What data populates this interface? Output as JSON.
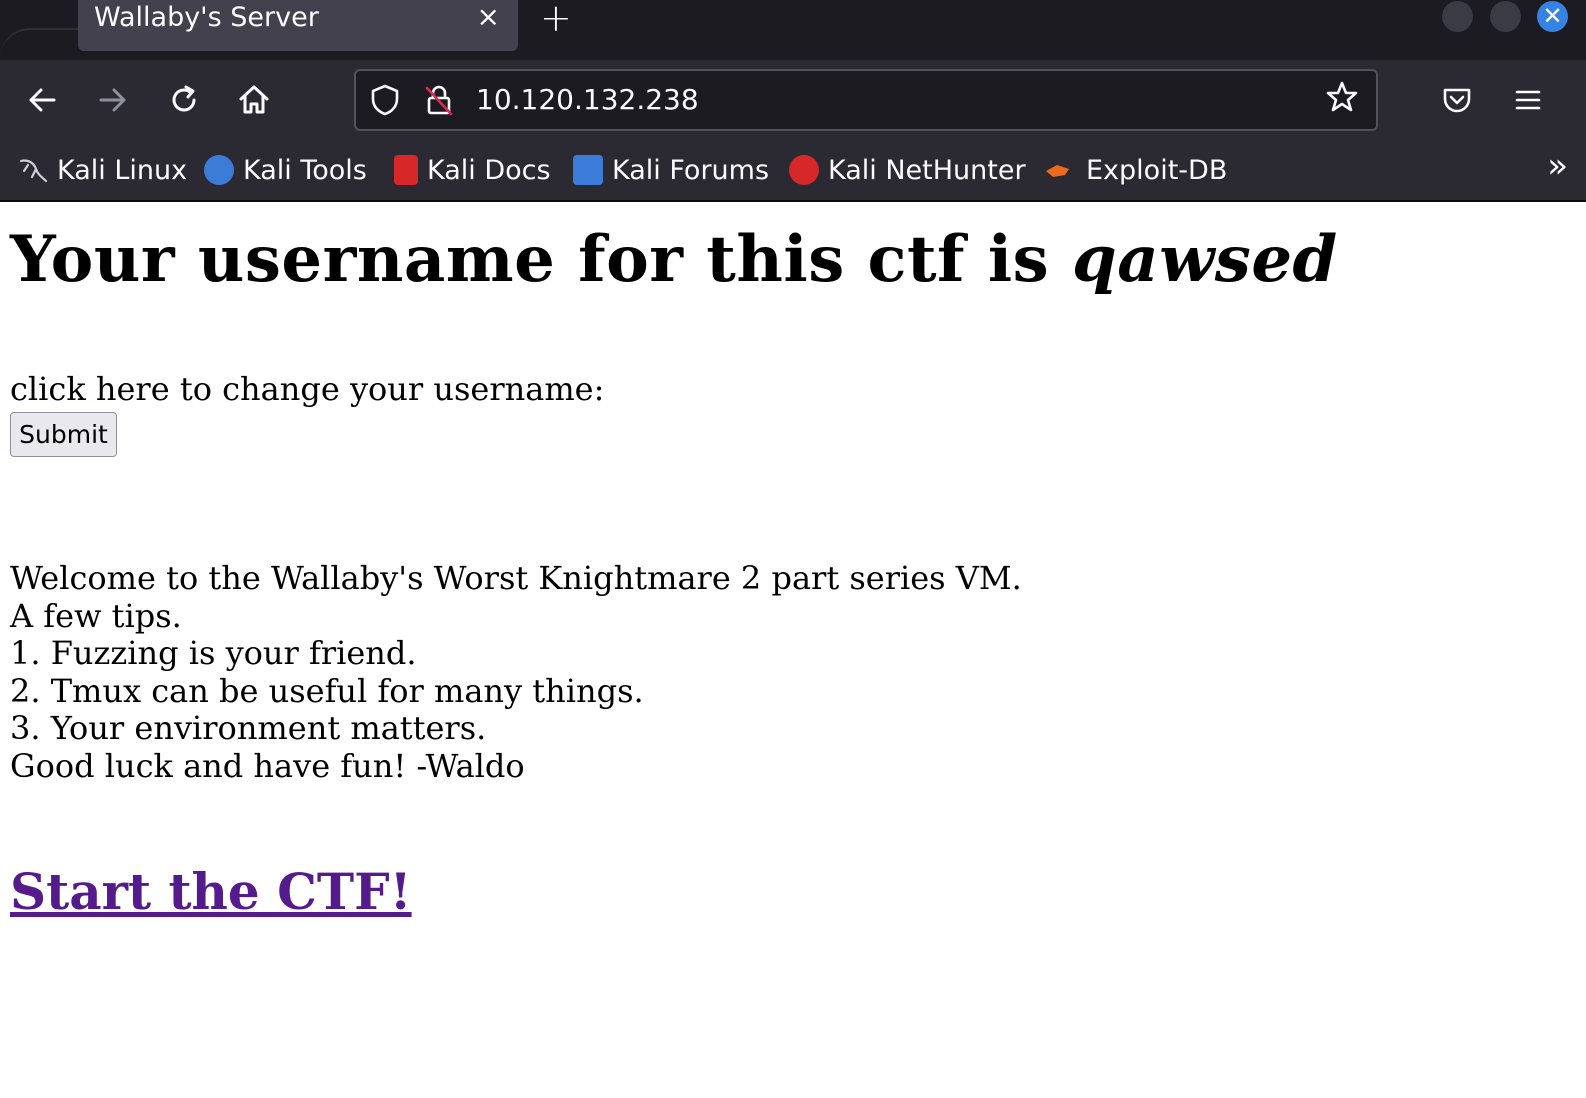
{
  "browser": {
    "tab_title": "Wallaby's Server",
    "tab_close": "×",
    "new_tab": "+",
    "url": "10.120.132.238",
    "bookmarks": [
      {
        "label": "Kali Linux",
        "icon": "kali-dragon-icon",
        "color": "#cccccc"
      },
      {
        "label": "Kali Tools",
        "icon": "kali-tools-icon",
        "color": "#3d7bd9"
      },
      {
        "label": "Kali Docs",
        "icon": "kali-docs-icon",
        "color": "#d62828"
      },
      {
        "label": "Kali Forums",
        "icon": "kali-forums-icon",
        "color": "#3d7bd9"
      },
      {
        "label": "Kali NetHunter",
        "icon": "kali-nethunter-icon",
        "color": "#d62828"
      },
      {
        "label": "Exploit-DB",
        "icon": "exploit-db-icon",
        "color": "#ec6a1c"
      }
    ]
  },
  "page": {
    "headline_prefix": "Your username for this ctf is ",
    "username": "qawsed",
    "change_label": "click here to change your username:",
    "submit_label": "Submit",
    "welcome_lines": [
      "Welcome to the Wallaby's Worst Knightmare 2 part series VM.",
      "A few tips.",
      "1. Fuzzing is your friend.",
      "2. Tmux can be useful for many things.",
      "3. Your environment matters.",
      "Good luck and have fun! -Waldo"
    ],
    "start_link": "Start the CTF!",
    "link_color": "#551a8b"
  }
}
